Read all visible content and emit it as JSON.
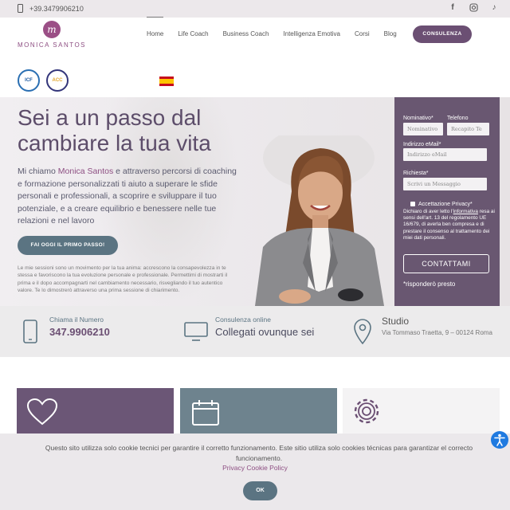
{
  "topbar": {
    "phone": "+39.3479906210",
    "social": [
      "facebook-icon",
      "instagram-icon",
      "tiktok-icon"
    ]
  },
  "header": {
    "logo_text": "MONICA SANTOS",
    "logo_initial": "m",
    "nav": [
      "Home",
      "Life Coach",
      "Business Coach",
      "Intelligenza Emotiva",
      "Corsi",
      "Blog"
    ],
    "active_nav": "Home",
    "cta": "CONSULENZA",
    "badges": [
      "ICF",
      "ACC"
    ],
    "language_flag": "spain-flag"
  },
  "hero": {
    "title_line1": "Sei a un passo dal",
    "title_line2": "cambiare la tua vita",
    "intro_pre": "Mi chiamo ",
    "intro_name": "Monica Santos",
    "intro_post": " e attraverso percorsi di coaching e formazione personalizzati ti aiuto a superare le sfide personali e professionali, a scoprire e sviluppare il tuo potenziale, e a creare equilibrio e benessere nelle tue relazioni e nel lavoro",
    "cta": "FAI OGGI IL PRIMO PASSO!",
    "small_text": "Le mie sessioni sono un movimento per la tua anima: accrescono la consapevolezza in te stessa e favoriscono la tua evoluzione personale e professionale. Permettimi di mostrarti il prima e il dopo accompagnarti nel cambiamento necessario, risvegliando il tuo autentico valore. Te lo dimostrerò attraverso una prima sessione di chiarimento."
  },
  "form": {
    "name_label": "Nominativo*",
    "name_placeholder": "Nominativo",
    "phone_label": "Telefono",
    "phone_placeholder": "Recapito Te",
    "email_label": "Indirizzo eMail*",
    "email_placeholder": "Indirizzo eMail",
    "request_label": "Richiesta*",
    "request_placeholder": "Scrivi un Messaggio",
    "privacy_label": "Accettazione Privacy*",
    "legal_pre": "Dichiaro di aver letto l'",
    "legal_link": "informativa",
    "legal_post": " resa ai sensi dell'art. 13 del regolamento UE 16/679, di averla ben compresa e di prestare il consenso al trattamento dei miei dati personali.",
    "submit": "CONTATTAMI",
    "note": "*risponderò presto"
  },
  "info": {
    "call_label": "Chiama il Numero",
    "call_value": "347.9906210",
    "online_label": "Consulenza online",
    "online_value": "Collegati ovunque sei",
    "studio_label": "Studio",
    "studio_address": "Via Tommaso Traetta, 9 – 00124 Roma"
  },
  "cards": [
    {
      "icon": "heart-icon",
      "color": "#6b5676"
    },
    {
      "icon": "calendar-icon",
      "color": "#6e838e"
    },
    {
      "icon": "gear-icon",
      "color": "#f4f3f4"
    }
  ],
  "cookie": {
    "text": "Questo sito utilizza solo cookie tecnici per garantire il corretto funzionamento. Este sitio utiliza solo cookies técnicas para garantizar el correcto funcionamento.",
    "link": "Privacy Cookie Policy",
    "ok": "OK"
  },
  "colors": {
    "brand": "#6b4f73",
    "accent": "#8d4e82",
    "teal": "#5b7482",
    "accessibility": "#1f7ae0"
  }
}
